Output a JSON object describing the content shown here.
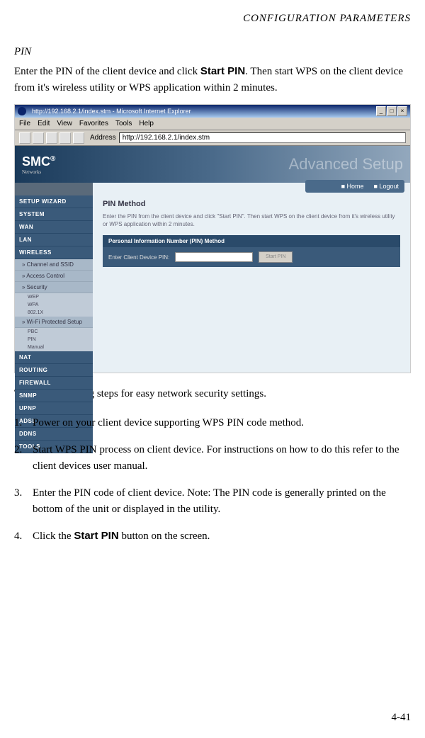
{
  "header": {
    "right": "CONFIGURATION PARAMETERS"
  },
  "section": {
    "title": "PIN",
    "intro_pre": "Enter the PIN of the client device and click ",
    "intro_bold": "Start PIN",
    "intro_post": ". Then start WPS on the client device from it's wireless utility or WPS application within 2 minutes."
  },
  "screenshot": {
    "titlebar": "http://192.168.2.1/index.stm - Microsoft Internet Explorer",
    "menus": [
      "File",
      "Edit",
      "View",
      "Favorites",
      "Tools",
      "Help"
    ],
    "address_label": "Address",
    "address_value": "http://192.168.2.1/index.stm",
    "logo": "SMC",
    "logo_reg": "®",
    "logo_sub": "Networks",
    "banner_large": "Advanced Setup",
    "banner_links": [
      "Home",
      "Logout"
    ],
    "sidebar": [
      {
        "label": "SETUP WIZARD",
        "type": "main"
      },
      {
        "label": "SYSTEM",
        "type": "main"
      },
      {
        "label": "WAN",
        "type": "main"
      },
      {
        "label": "LAN",
        "type": "main"
      },
      {
        "label": "WIRELESS",
        "type": "main"
      },
      {
        "label": "Channel and SSID",
        "type": "sub"
      },
      {
        "label": "Access Control",
        "type": "sub"
      },
      {
        "label": "Security",
        "type": "sub"
      },
      {
        "label": "WEP",
        "type": "sub2"
      },
      {
        "label": "WPA",
        "type": "sub2"
      },
      {
        "label": "802.1X",
        "type": "sub2"
      },
      {
        "label": "Wi-Fi Protected Setup",
        "type": "sub"
      },
      {
        "label": "PBC",
        "type": "sub2"
      },
      {
        "label": "PIN",
        "type": "sub2"
      },
      {
        "label": "Manual",
        "type": "sub2"
      },
      {
        "label": "NAT",
        "type": "main"
      },
      {
        "label": "ROUTING",
        "type": "main"
      },
      {
        "label": "FIREWALL",
        "type": "main"
      },
      {
        "label": "SNMP",
        "type": "main"
      },
      {
        "label": "UPNP",
        "type": "main"
      },
      {
        "label": "ADSL",
        "type": "main"
      },
      {
        "label": "DDNS",
        "type": "main"
      },
      {
        "label": "TOOLS",
        "type": "main"
      }
    ],
    "panel": {
      "title": "PIN Method",
      "desc": "Enter the PIN from the client device and click \"Start PIN\". Then start WPS on the client device from it's wireless utility or WPS application within 2 minutes.",
      "section_header": "Personal Information Number (PIN) Method",
      "field_label": "Enter Client Device PIN:",
      "button_label": "Start PIN"
    }
  },
  "after_text": "Take the following steps for easy network security settings.",
  "steps": [
    {
      "text": " Power on your client device supporting WPS PIN code method."
    },
    {
      "text": "Start WPS PIN process on client device. For instructions on how to do this refer to the client devices user manual."
    },
    {
      "text": "Enter the PIN code of client device. Note: The PIN code is generally printed on the bottom of the unit or displayed in the utility."
    },
    {
      "pre": "Click the ",
      "bold": "Start PIN",
      "post": " button on the screen."
    }
  ],
  "page_number": "4-41"
}
